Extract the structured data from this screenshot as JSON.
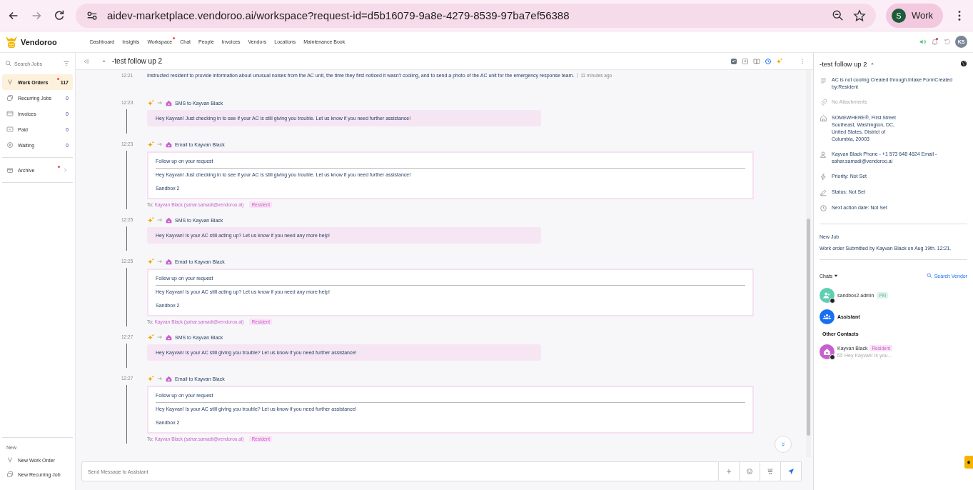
{
  "browser": {
    "url": "aidev-marketplace.vendoroo.ai/workspace?request-id=d5b16079-9a8e-4279-8539-97ba7ef56388",
    "profile_initial": "S",
    "profile_label": "Work"
  },
  "header": {
    "logo": "Vendoroo",
    "nav": [
      {
        "label": "Dashboard",
        "dot": false
      },
      {
        "label": "Insights",
        "dot": false
      },
      {
        "label": "Workspace",
        "dot": true
      },
      {
        "label": "Chat",
        "dot": false
      },
      {
        "label": "People",
        "dot": false
      },
      {
        "label": "Invoices",
        "dot": false
      },
      {
        "label": "Vendors",
        "dot": false
      },
      {
        "label": "Locations",
        "dot": false
      },
      {
        "label": "Maintenance Book",
        "dot": false
      }
    ],
    "notification_dot": true,
    "user_initials": "KS"
  },
  "sidebar": {
    "search_placeholder": "Search Jobs",
    "items": [
      {
        "kind": "wrench",
        "label": "Work Orders",
        "count": "117",
        "selected": true,
        "dot": true
      },
      {
        "kind": "stack",
        "label": "Recurring Jobs",
        "count": "0",
        "selected": false,
        "dot": false
      },
      {
        "kind": "card",
        "label": "Invoices",
        "count": "0",
        "selected": false,
        "dot": false
      },
      {
        "kind": "check",
        "label": "Paid",
        "count": "0",
        "selected": false,
        "dot": false
      },
      {
        "kind": "pause",
        "label": "Waiting",
        "count": "0",
        "selected": false,
        "dot": false
      }
    ],
    "archive": {
      "label": "Archive",
      "dot": true
    },
    "new_title": "New",
    "new_items": [
      {
        "kind": "wrench",
        "label": "New Work Order"
      },
      {
        "kind": "stack",
        "label": "New Recurring Job"
      }
    ]
  },
  "main": {
    "title": "-test follow up 2",
    "messages": [
      {
        "kind": "note",
        "time": "12:21",
        "text": "Instructed resident to provide information about unusual noises from the AC unit, the time they first noticed it wasn't cooling, and to send a photo of the AC unit for the emergency response team.",
        "age": "11 minutes ago"
      },
      {
        "kind": "sms",
        "time": "12:23",
        "label": "SMS to Kayvan Black",
        "body": "Hey Kayvan! Just checking in to see if your AC is still giving you trouble. Let us know if you need further assistance!"
      },
      {
        "kind": "email",
        "time": "12:23",
        "label": "Email to Kayvan Black",
        "subject": "Follow up on your request",
        "body": "Hey Kayvan! Just checking in to see if your AC is still giving you trouble. Let us know if you need further assistance!",
        "signature": "Sandbox 2",
        "to_label": "To:",
        "to": "Kayvan Black (sahar.samadi@vendoroo.ai)",
        "tag": "Resident"
      },
      {
        "kind": "sms",
        "time": "12:25",
        "label": "SMS to Kayvan Black",
        "body": "Hey Kayvan! Is your AC still acting up? Let us know if you need any more help!"
      },
      {
        "kind": "email",
        "time": "12:25",
        "label": "Email to Kayvan Black",
        "subject": "Follow up on your request",
        "body": "Hey Kayvan! Is your AC still acting up? Let us know if you need any more help!",
        "signature": "Sandbox 2",
        "to_label": "To:",
        "to": "Kayvan Black (sahar.samadi@vendoroo.ai)",
        "tag": "Resident"
      },
      {
        "kind": "sms",
        "time": "12:27",
        "label": "SMS to Kayvan Black",
        "body": "Hey Kayvan! Is your AC still giving you trouble? Let us know if you need further assistance!"
      },
      {
        "kind": "email",
        "time": "12:27",
        "label": "Email to Kayvan Black",
        "subject": "Follow up on your request",
        "body": "Hey Kayvan! Is your AC still giving you trouble? Let us know if you need further assistance!",
        "signature": "Sandbox 2",
        "to_label": "To:",
        "to": "Kayvan Black (sahar.samadi@vendoroo.ai)",
        "tag": "Resident"
      }
    ],
    "composer_placeholder": "Send Message to Assistant"
  },
  "details": {
    "title": "-test follow up 2",
    "rows": [
      {
        "kind": "description",
        "text": "AC is not cooling Created through:Intake FormCreated by:Resident"
      },
      {
        "kind": "attachment",
        "text": "No Attachments"
      },
      {
        "kind": "address",
        "text": "SOMEWHERE®, First Street Southeast, Washington, DC, United States, District of Columbia, 20003"
      },
      {
        "kind": "contact",
        "text": "Kayvan Black Phone - +1 573 648 4624 Email - sahar.samadi@vendoroo.ai"
      },
      {
        "kind": "priority",
        "text": "Priority: Not Set"
      },
      {
        "kind": "status",
        "text": "Status: Not Set"
      },
      {
        "kind": "date",
        "text": "Next action date: Not Set"
      }
    ],
    "new_job_title": "New Job",
    "new_job_text": "Work order Submitted by Kayvan Black on Aug 19th. 12:21.",
    "chats_label": "Chats",
    "search_vendor": "Search Vendor",
    "chats": [
      {
        "kind": "person",
        "name": "sandbox2 admin",
        "tag": "PM",
        "color": "#5ecfb1"
      },
      {
        "kind": "group",
        "name": "Assistant",
        "color": "#1a6ff0"
      }
    ],
    "other_title": "Other Contacts",
    "contacts": [
      {
        "name": "Kayvan Black",
        "tag": "Resident",
        "preview": "Hey Kayvan! Is you...",
        "color": "#c85fcf"
      }
    ]
  }
}
